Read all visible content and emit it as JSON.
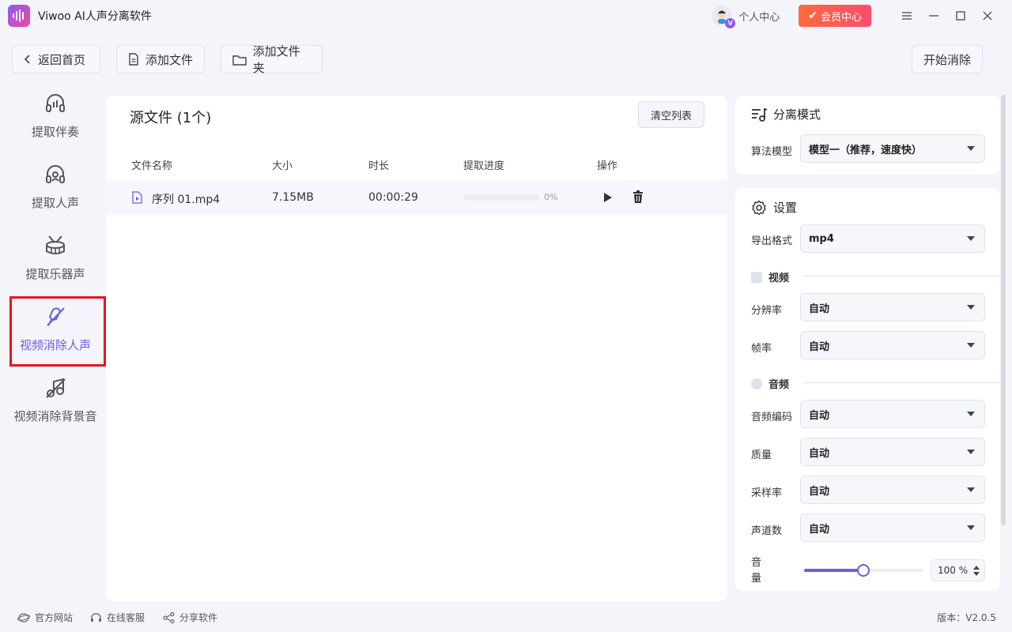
{
  "app": {
    "title": "Viwoo AI人声分离软件"
  },
  "header": {
    "personal_center": "个人中心",
    "vip_center": "会员中心",
    "vip_badge": "V"
  },
  "toolbar": {
    "back_home": "返回首页",
    "add_file": "添加文件",
    "add_folder": "添加文件夹",
    "start": "开始消除"
  },
  "sidebar": {
    "items": [
      {
        "label": "提取伴奏"
      },
      {
        "label": "提取人声"
      },
      {
        "label": "提取乐器声"
      },
      {
        "label": "视频消除人声"
      },
      {
        "label": "视频消除背景音"
      }
    ]
  },
  "file_panel": {
    "title": "源文件 (1个)",
    "clear_list": "清空列表",
    "columns": [
      "文件名称",
      "大小",
      "时长",
      "提取进度",
      "操作"
    ],
    "rows": [
      {
        "name": "序列 01.mp4",
        "size": "7.15MB",
        "duration": "00:00:29",
        "progress_text": "0%",
        "progress": 0
      }
    ]
  },
  "separation": {
    "title": "分离模式",
    "model_label": "算法模型",
    "model_value": "模型一（推荐，速度快）"
  },
  "settings": {
    "title": "设置",
    "format_label": "导出格式",
    "format_value": "mp4",
    "video_section": "视频",
    "resolution_label": "分辨率",
    "resolution_value": "自动",
    "framerate_label": "帧率",
    "framerate_value": "自动",
    "audio_section": "音频",
    "codec_label": "音频编码",
    "codec_value": "自动",
    "quality_label": "质量",
    "quality_value": "自动",
    "samplerate_label": "采样率",
    "samplerate_value": "自动",
    "channels_label": "声道数",
    "channels_value": "自动",
    "volume_label": "音量",
    "volume_value": "100 %",
    "volume_level": 0.5
  },
  "footer": {
    "website": "官方网站",
    "service": "在线客服",
    "share": "分享软件",
    "version": "版本：V2.0.5"
  },
  "colors": {
    "accent": "#6c5ce7",
    "vip": "#ff5a4e",
    "annotation": "#e8141d"
  }
}
